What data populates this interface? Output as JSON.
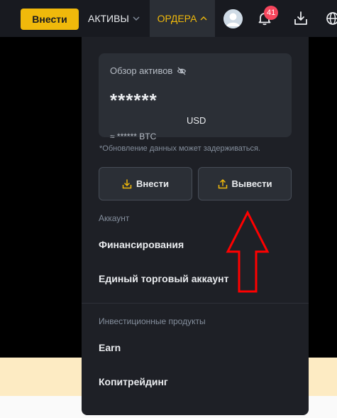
{
  "header": {
    "deposit_label": "Внести",
    "assets_label": "АКТИВЫ",
    "orders_label": "ОРДЕРА",
    "notifications_count": "41"
  },
  "overview": {
    "title": "Обзор активов",
    "balance_masked": "******",
    "currency": "USD",
    "btc_equivalent": "≈ ****** BTC",
    "note": "*Обновление данных может задерживаться."
  },
  "actions": {
    "deposit_label": "Внести",
    "withdraw_label": "Вывести"
  },
  "account_section": {
    "label": "Аккаунт",
    "items": [
      "Финансирования",
      "Единый торговый аккаунт"
    ]
  },
  "invest_section": {
    "label": "Инвестиционные продукты",
    "items": [
      "Earn",
      "Копитрейдинг"
    ]
  },
  "colors": {
    "brand": "#f0b90b",
    "panel_bg": "#1e2026",
    "badge": "#f6465d",
    "annotation": "#ff0000"
  }
}
